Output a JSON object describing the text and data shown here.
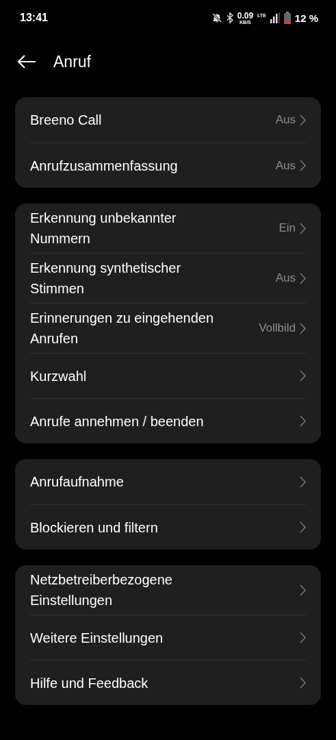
{
  "status_bar": {
    "time": "13:41",
    "speed_value": "0.09",
    "speed_unit": "KB/S",
    "network": "LTE",
    "battery": "12 %"
  },
  "header": {
    "title": "Anruf"
  },
  "groups": [
    {
      "items": [
        {
          "label": "Breeno Call",
          "value": "Aus"
        },
        {
          "label": "Anrufzusammenfassung",
          "value": "Aus"
        }
      ]
    },
    {
      "items": [
        {
          "label": "Erkennung unbekannter Nummern",
          "value": "Ein"
        },
        {
          "label": "Erkennung synthetischer Stimmen",
          "value": "Aus"
        },
        {
          "label": "Erinnerungen zu eingehenden Anrufen",
          "value": "Vollbild"
        },
        {
          "label": "Kurzwahl"
        },
        {
          "label": "Anrufe annehmen / beenden"
        }
      ]
    },
    {
      "items": [
        {
          "label": "Anrufaufnahme"
        },
        {
          "label": "Blockieren und filtern"
        }
      ]
    },
    {
      "items": [
        {
          "label": "Netzbetreiberbezogene Einstellungen"
        },
        {
          "label": "Weitere Einstellungen"
        },
        {
          "label": "Hilfe und Feedback"
        }
      ]
    }
  ]
}
